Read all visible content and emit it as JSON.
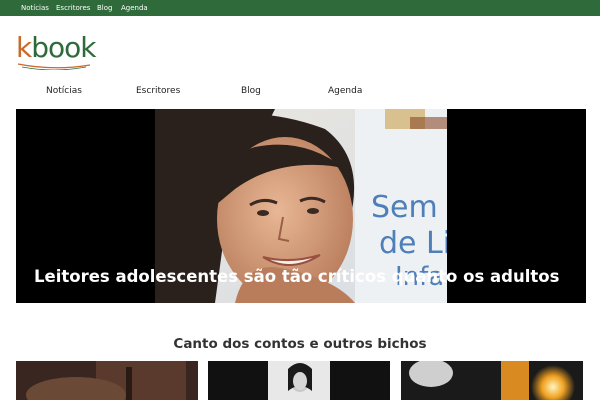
{
  "top_nav": {
    "items": [
      {
        "label": "Notícias"
      },
      {
        "label": "Escritores"
      },
      {
        "label": "Blog"
      },
      {
        "label": "Agenda"
      }
    ]
  },
  "logo": {
    "text_k": "k",
    "text_rest": "book"
  },
  "main_nav": {
    "items": [
      {
        "label": "Notícias"
      },
      {
        "label": "Escritores"
      },
      {
        "label": "Blog"
      },
      {
        "label": "Agenda"
      }
    ]
  },
  "hero": {
    "headline": "Leitores adolescentes são tão críticos quanto os adultos",
    "backdrop_text": [
      "Sem",
      "de Li",
      "Infa"
    ]
  },
  "section": {
    "title": "Canto dos contos e outros bichos"
  },
  "colors": {
    "topbar": "#2f6b3a",
    "logo_orange": "#c96a2a",
    "logo_green": "#2f6b3a",
    "backdrop_blue": "#4f7fb8"
  }
}
